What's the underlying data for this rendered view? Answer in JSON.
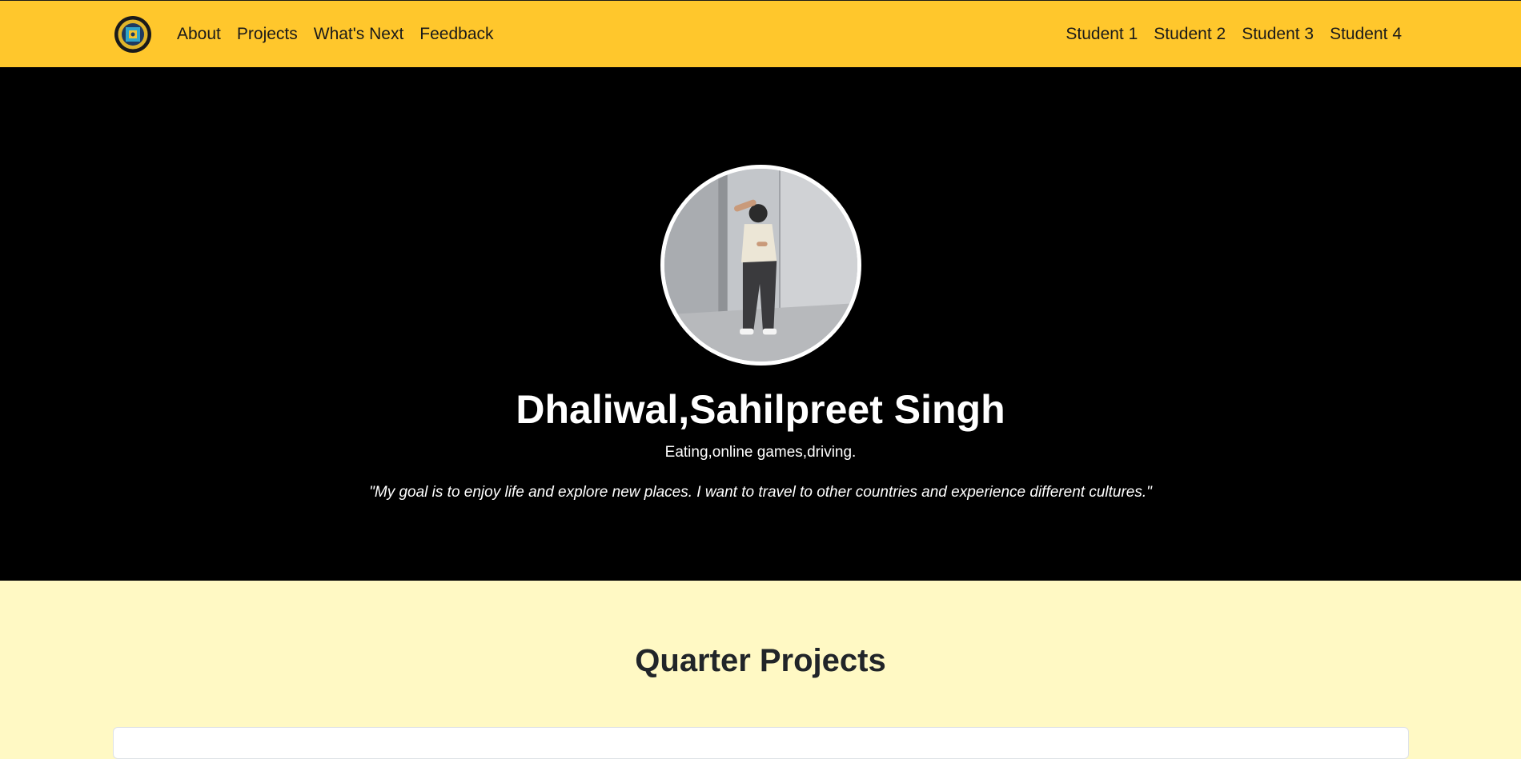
{
  "nav": {
    "logo_icon": "school-seal-logo",
    "left_links": [
      "About",
      "Projects",
      "What's Next",
      "Feedback"
    ],
    "right_links": [
      "Student 1",
      "Student 2",
      "Student 3",
      "Student 4"
    ]
  },
  "hero": {
    "name": "Dhaliwal,Sahilpreet Singh",
    "hobbies": "Eating,online games,driving.",
    "quote": "\"My goal is to enjoy life and explore new places. I want to travel to other countries and experience different cultures.\""
  },
  "projects": {
    "title": "Quarter Projects"
  },
  "colors": {
    "navbar": "#ffc72c",
    "hero_bg": "#000000",
    "section_bg": "#fff9c4",
    "text_dark": "#212529"
  }
}
